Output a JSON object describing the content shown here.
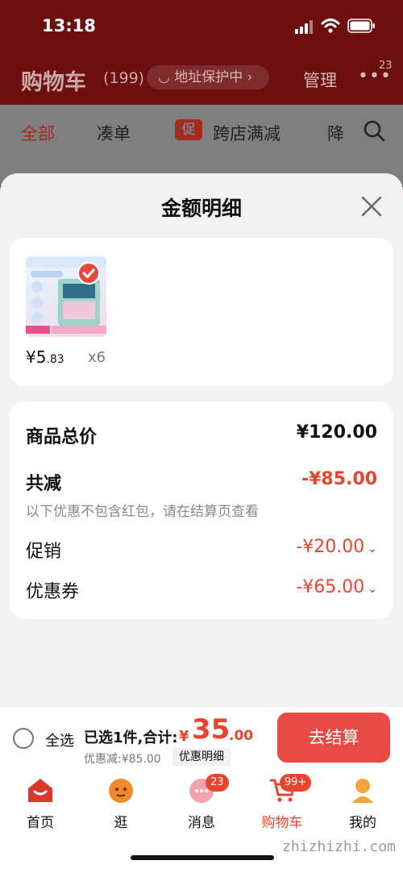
{
  "status": {
    "time": "13:18"
  },
  "header": {
    "title": "购物车",
    "count": "(199)",
    "address_pill": "地址保护中",
    "manage": "管理",
    "more_badge": "23"
  },
  "tabs": {
    "all": "全部",
    "bundle": "凑单",
    "cross_store_badge": "促",
    "cross_store": "跨店满减",
    "partial": "降"
  },
  "sheet": {
    "title": "金额明细",
    "product": {
      "price_int": "¥5",
      "price_dec": ".83",
      "qty": "x6"
    },
    "rows": {
      "goods_total_label": "商品总价",
      "goods_total_value": "¥120.00",
      "total_off_label": "共减",
      "total_off_value": "-¥85.00",
      "note": "以下优惠不包含红包，请在结算页查看",
      "promo_label": "促销",
      "promo_value": "-¥20.00",
      "coupon_label": "优惠券",
      "coupon_value": "-¥65.00"
    }
  },
  "checkout": {
    "select_all": "全选",
    "selected_summary": "已选1件,合计:",
    "yen": "¥",
    "total_int": "35",
    "total_dec": ".00",
    "discount": "优惠减:¥85.00",
    "discount_detail": "优惠明细",
    "button": "去结算"
  },
  "tabbar": {
    "home": "首页",
    "browse": "逛",
    "messages": "消息",
    "messages_badge": "23",
    "cart": "购物车",
    "cart_badge": "99+",
    "me": "我的"
  },
  "watermark": "zhizhizhi.com",
  "colors": {
    "accent": "#e8452f",
    "checkout_button": "#e84a45"
  }
}
